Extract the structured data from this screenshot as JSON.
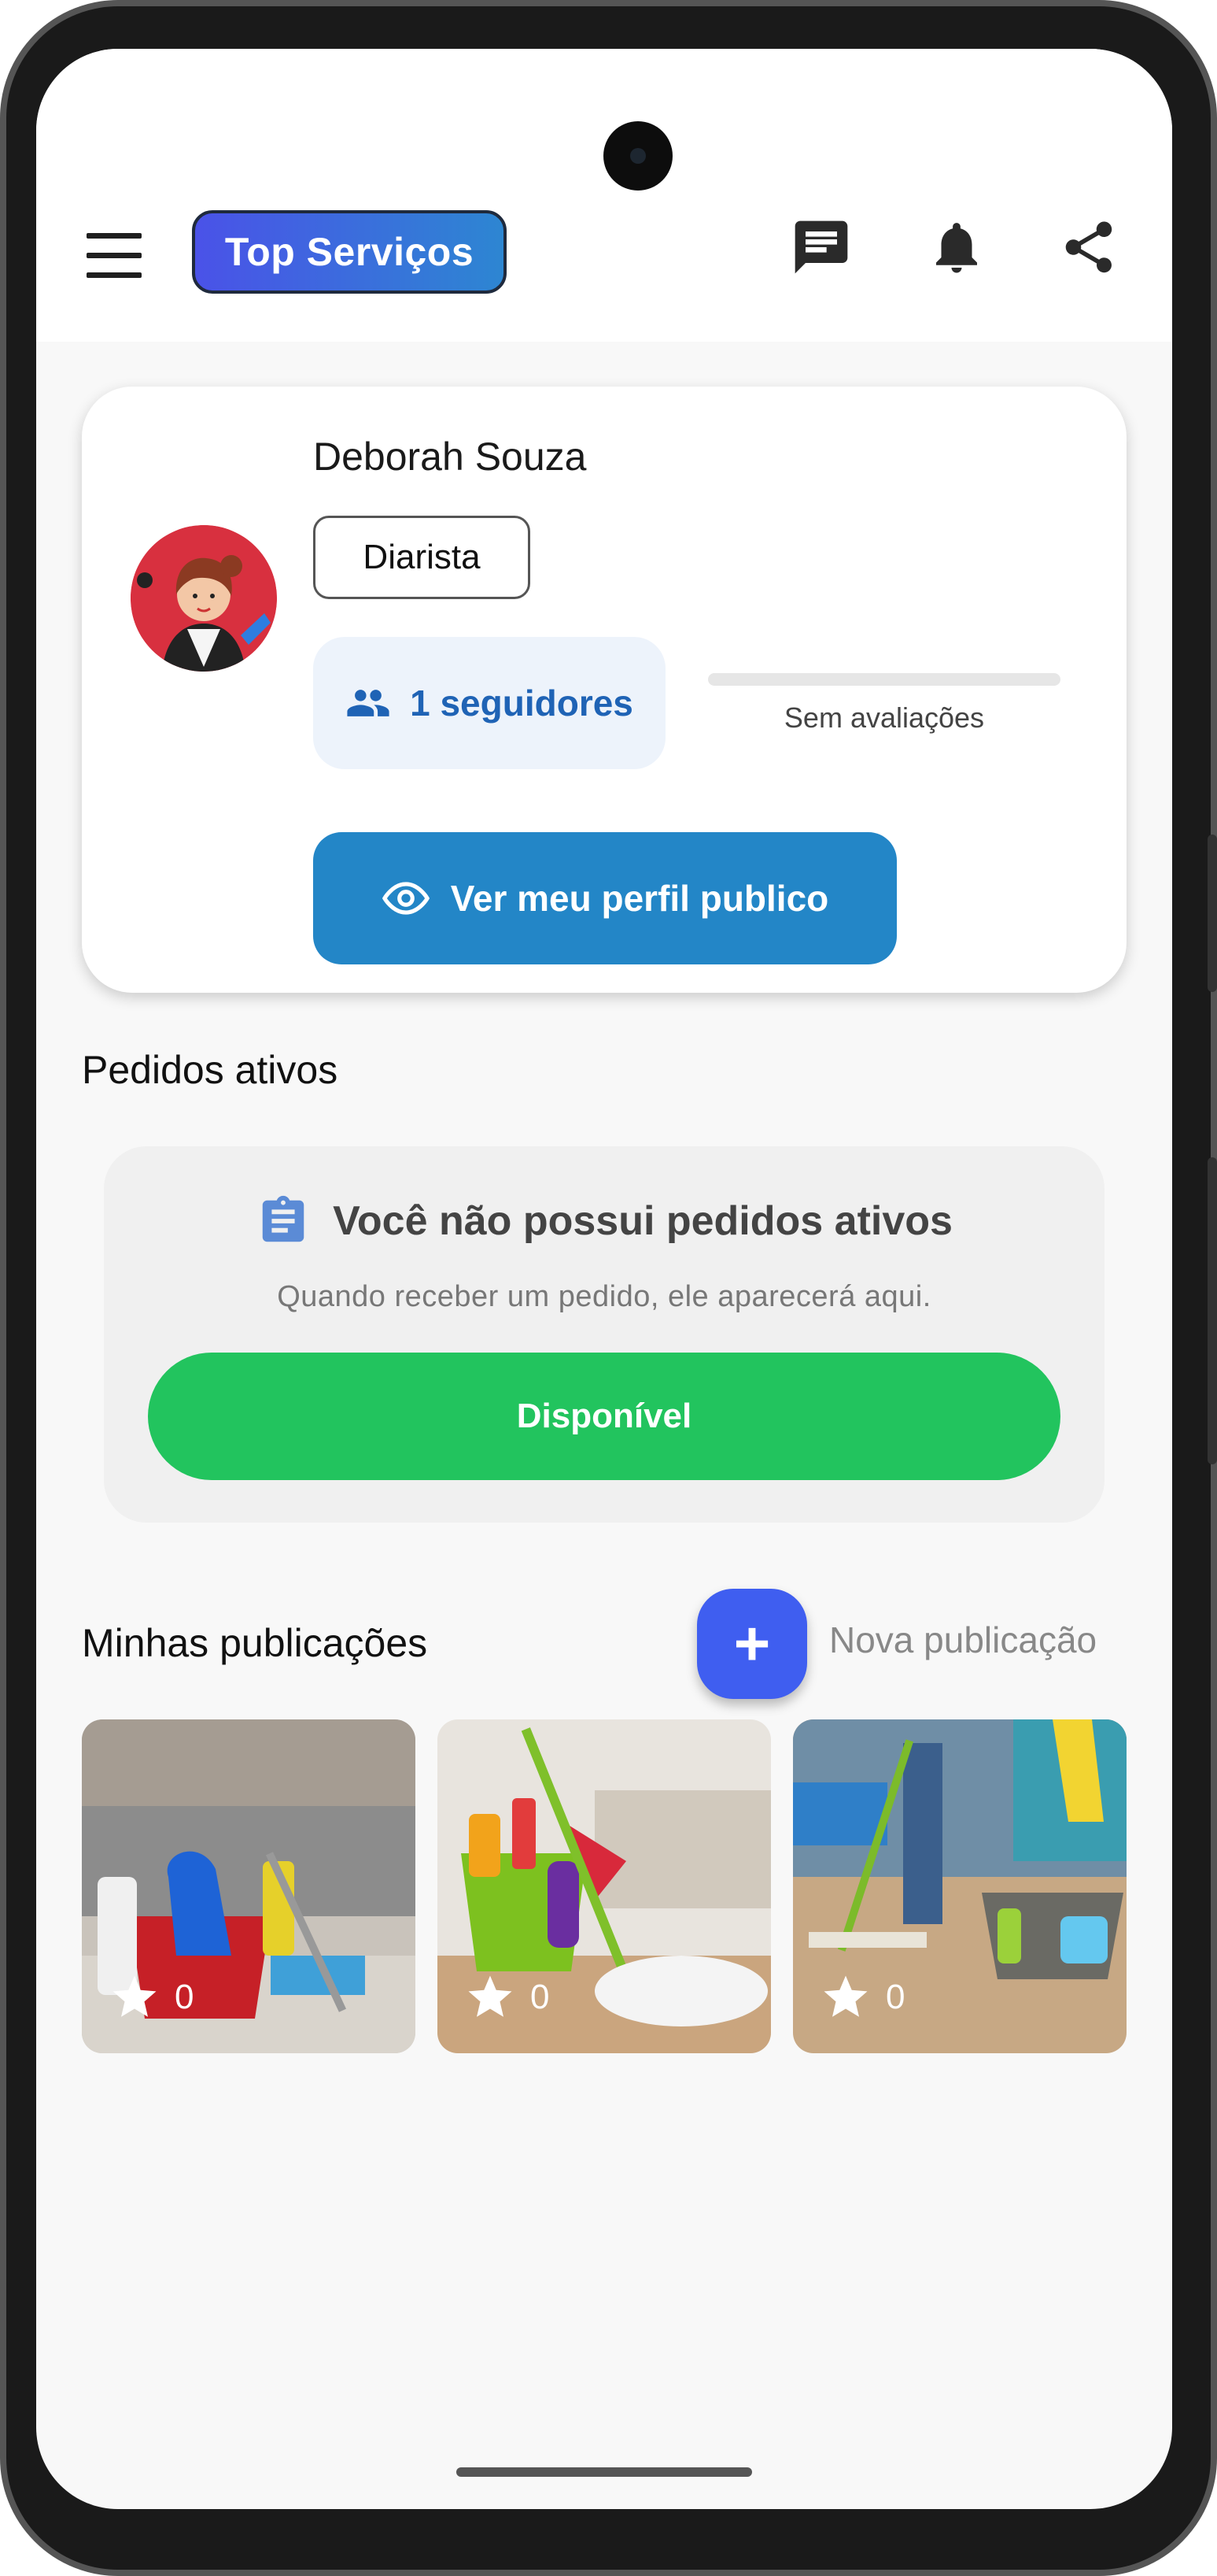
{
  "header": {
    "brand": "Top Serviços",
    "icons": [
      "menu-icon",
      "chat-icon",
      "bell-icon",
      "share-icon"
    ]
  },
  "profile": {
    "name": "Deborah Souza",
    "role": "Diarista",
    "followers_label": "1 seguidores",
    "rating_label": "Sem avaliações",
    "public_profile_button": "Ver meu perfil publico"
  },
  "orders": {
    "section_title": "Pedidos ativos",
    "empty_title": "Você não possui pedidos ativos",
    "empty_subtitle": "Quando receber um pedido, ele aparecerá aqui.",
    "status_button": "Disponível"
  },
  "publications": {
    "section_title": "Minhas publicações",
    "new_label": "Nova publicação",
    "items": [
      {
        "likes": "0"
      },
      {
        "likes": "0"
      },
      {
        "likes": "0"
      }
    ]
  },
  "colors": {
    "brand_gradient_start": "#4a52e8",
    "brand_gradient_end": "#2d86d2",
    "primary_button": "#2386c7",
    "available_button": "#22c45e",
    "fab": "#3f5ef0",
    "followers_text": "#1f63b5"
  }
}
